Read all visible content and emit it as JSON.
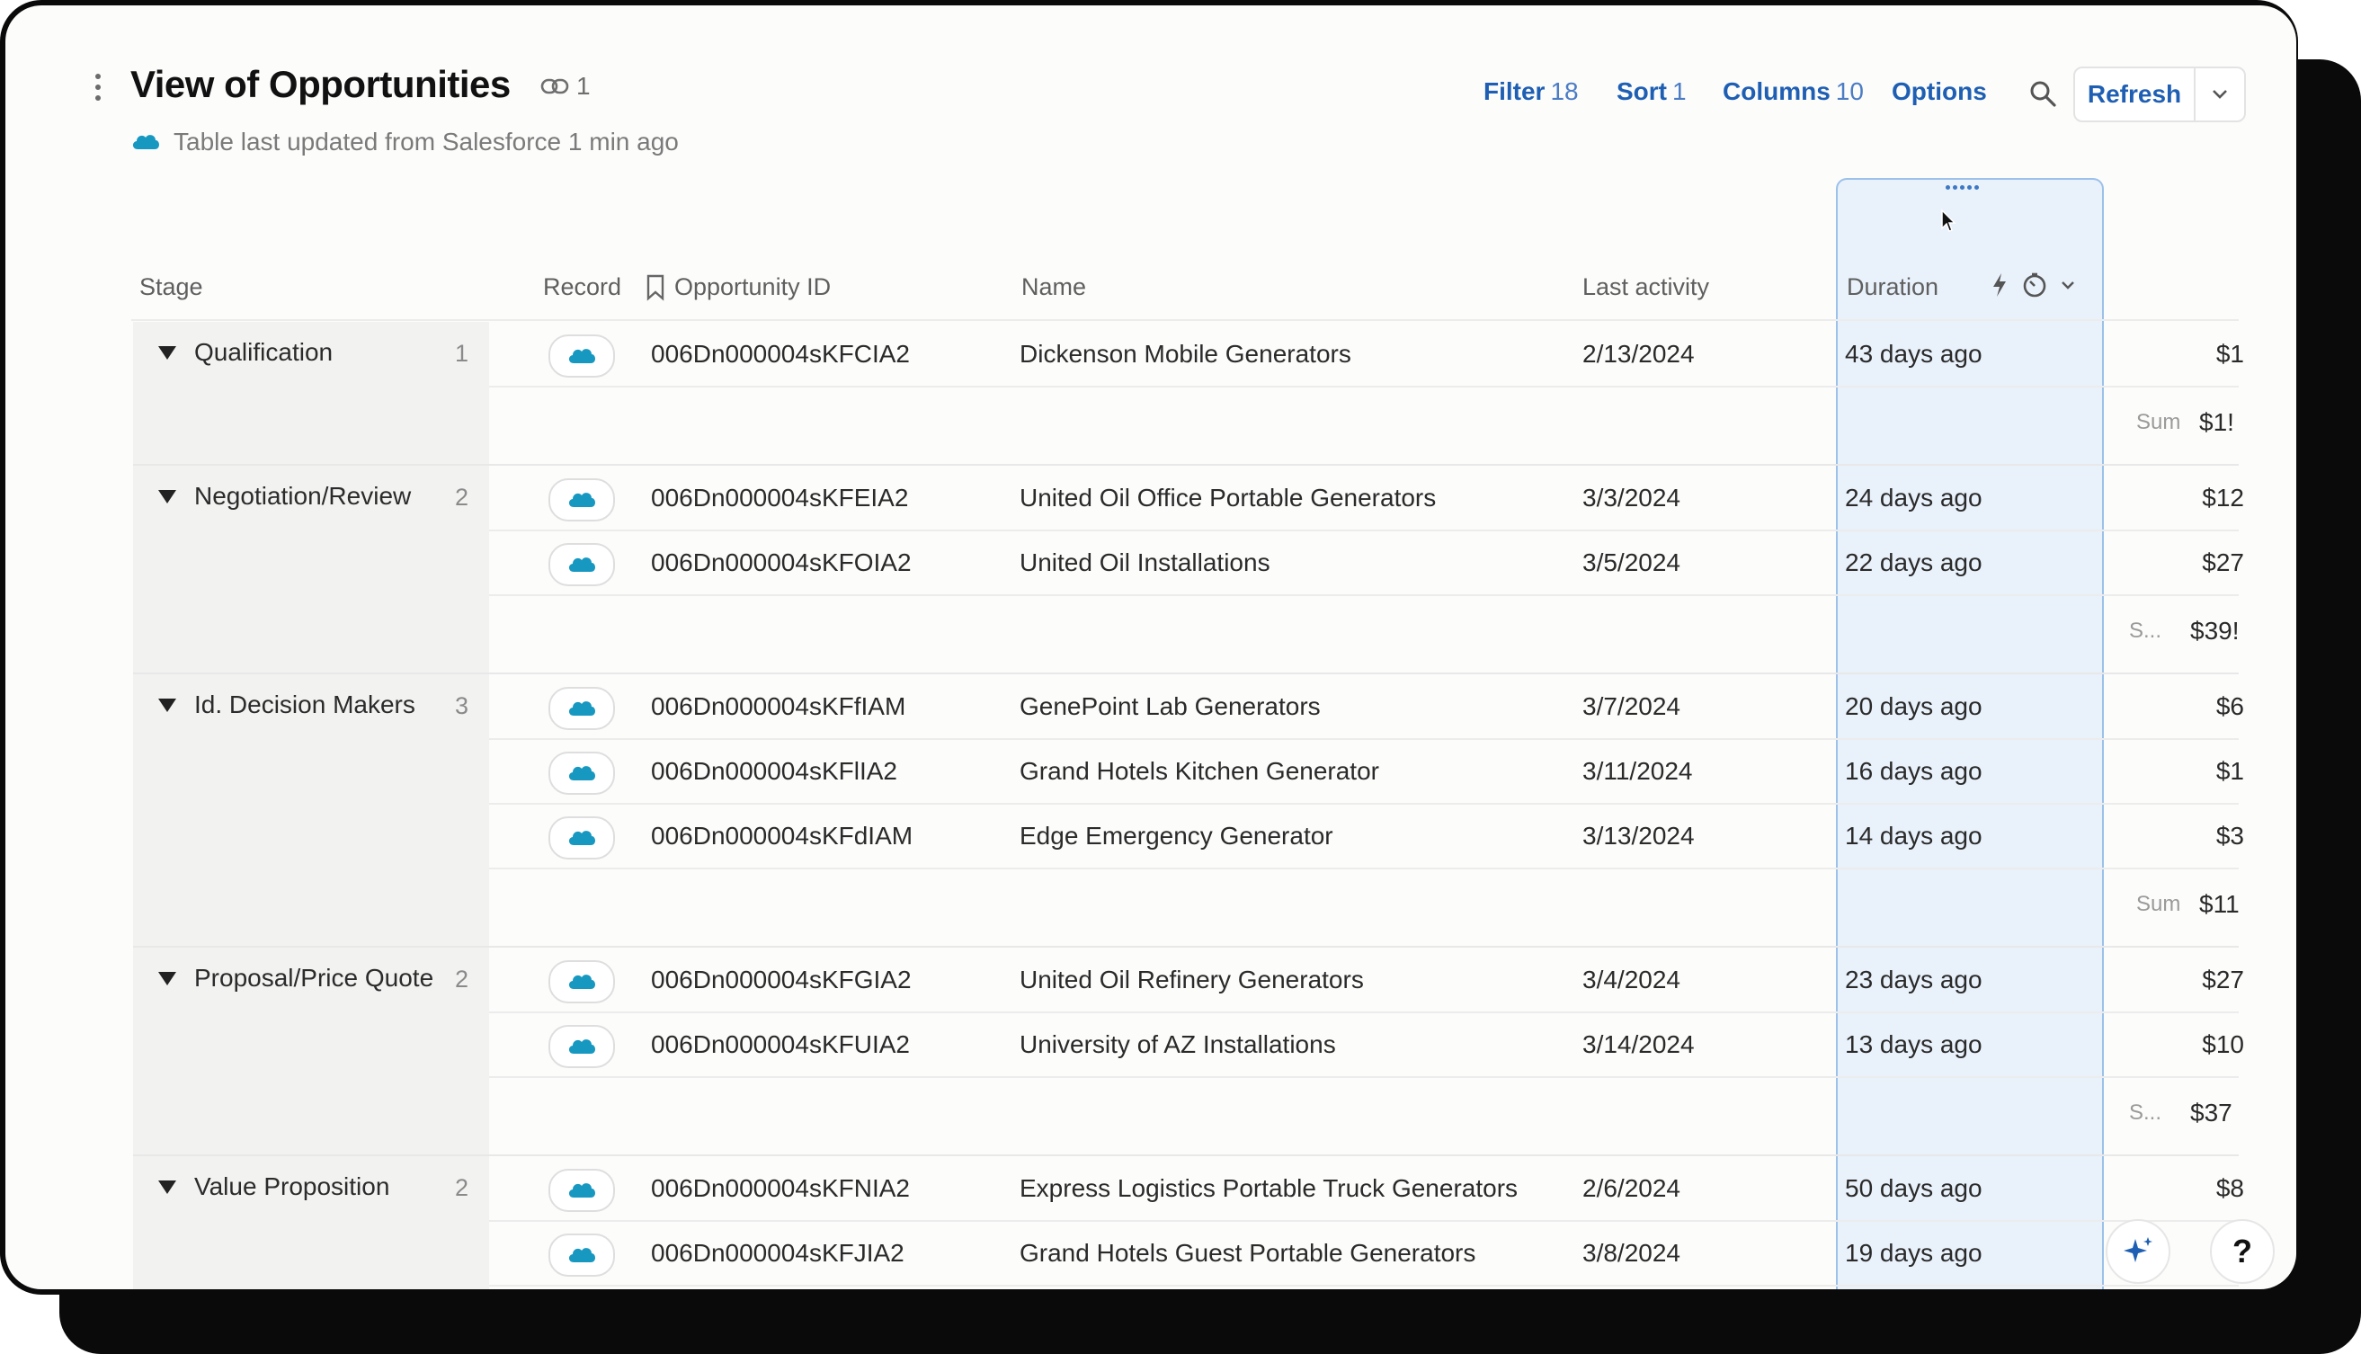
{
  "header": {
    "title": "View of Opportunities",
    "link_count": "1",
    "subtitle": "Table last updated from Salesforce 1 min ago"
  },
  "toolbar": {
    "filter_label": "Filter",
    "filter_count": "18",
    "sort_label": "Sort",
    "sort_count": "1",
    "columns_label": "Columns",
    "columns_count": "10",
    "options_label": "Options",
    "refresh_label": "Refresh"
  },
  "columns": {
    "stage": "Stage",
    "record": "Record",
    "opportunity_id": "Opportunity ID",
    "name": "Name",
    "last_activity": "Last activity",
    "duration": "Duration"
  },
  "groups": [
    {
      "label": "Qualification",
      "count": "1",
      "sum_label": "Sum",
      "sum_value": "$1!",
      "rows": [
        {
          "id": "006Dn000004sKFCIA2",
          "name": "Dickenson Mobile Generators",
          "last_activity": "2/13/2024",
          "duration": "43 days ago",
          "amount": "$1"
        }
      ]
    },
    {
      "label": "Negotiation/Review",
      "count": "2",
      "sum_label": "S...",
      "sum_value": "$39!",
      "rows": [
        {
          "id": "006Dn000004sKFEIA2",
          "name": "United Oil Office Portable Generators",
          "last_activity": "3/3/2024",
          "duration": "24 days ago",
          "amount": "$12"
        },
        {
          "id": "006Dn000004sKFOIA2",
          "name": "United Oil Installations",
          "last_activity": "3/5/2024",
          "duration": "22 days ago",
          "amount": "$27"
        }
      ]
    },
    {
      "label": "Id. Decision Makers",
      "count": "3",
      "sum_label": "Sum",
      "sum_value": "$11",
      "rows": [
        {
          "id": "006Dn000004sKFfIAM",
          "name": "GenePoint Lab Generators",
          "last_activity": "3/7/2024",
          "duration": "20 days ago",
          "amount": "$6"
        },
        {
          "id": "006Dn000004sKFlIA2",
          "name": "Grand Hotels Kitchen Generator",
          "last_activity": "3/11/2024",
          "duration": "16 days ago",
          "amount": "$1"
        },
        {
          "id": "006Dn000004sKFdIAM",
          "name": "Edge Emergency Generator",
          "last_activity": "3/13/2024",
          "duration": "14 days ago",
          "amount": "$3"
        }
      ]
    },
    {
      "label": "Proposal/Price Quote",
      "count": "2",
      "sum_label": "S...",
      "sum_value": "$37",
      "rows": [
        {
          "id": "006Dn000004sKFGIA2",
          "name": "United Oil Refinery Generators",
          "last_activity": "3/4/2024",
          "duration": "23 days ago",
          "amount": "$27"
        },
        {
          "id": "006Dn000004sKFUIA2",
          "name": "University of AZ Installations",
          "last_activity": "3/14/2024",
          "duration": "13 days ago",
          "amount": "$10"
        }
      ]
    },
    {
      "label": "Value Proposition",
      "count": "2",
      "rows": [
        {
          "id": "006Dn000004sKFNIA2",
          "name": "Express Logistics Portable Truck Generators",
          "last_activity": "2/6/2024",
          "duration": "50 days ago",
          "amount": "$8"
        },
        {
          "id": "006Dn000004sKFJIA2",
          "name": "Grand Hotels Guest Portable Generators",
          "last_activity": "3/8/2024",
          "duration": "19 days ago",
          "amount": "$"
        }
      ]
    }
  ],
  "icons": {
    "kebab": "kebab-menu-icon",
    "link": "link-icon",
    "salesforce": "salesforce-cloud-icon",
    "search": "search-icon",
    "chevron": "chevron-down-icon",
    "bookmark": "bookmark-icon",
    "lightning": "lightning-icon",
    "timer": "timer-icon",
    "sparkle": "sparkle-icon",
    "help": "help-icon"
  },
  "colors": {
    "accent": "#1f5fb3",
    "salesforce": "#1798c1",
    "highlight_column": "#e9f1fb"
  }
}
